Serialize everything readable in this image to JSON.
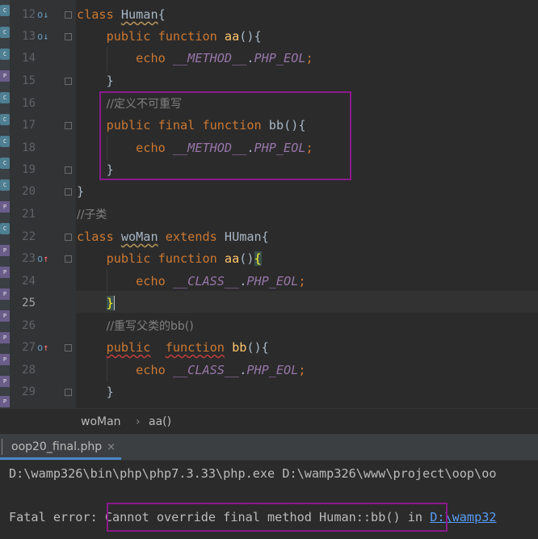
{
  "editor": {
    "line_numbers": [
      "12",
      "13",
      "14",
      "15",
      "16",
      "17",
      "18",
      "19",
      "20",
      "21",
      "22",
      "23",
      "24",
      "25",
      "26",
      "27",
      "28",
      "29"
    ],
    "active_line": "25",
    "lines": {
      "l12": {
        "kw": "class",
        "name": "Human",
        "brace": "{"
      },
      "l13": {
        "kw1": "public",
        "kw2": "function",
        "fn": "aa",
        "rest": "(){"
      },
      "l14": {
        "kw": "echo",
        "const1": "__METHOD__",
        "dot": ".",
        "const2": "PHP_EOL",
        "semi": ";"
      },
      "l15": {
        "text": "}"
      },
      "l16": {
        "comment": "//定义不可重写"
      },
      "l17": {
        "kw1": "public",
        "kw2": "final",
        "kw3": "function",
        "fn": "bb",
        "rest": "(){"
      },
      "l18": {
        "kw": "echo",
        "const1": "__METHOD__",
        "dot": ".",
        "const2": "PHP_EOL",
        "semi": ";"
      },
      "l19": {
        "text": "}"
      },
      "l20": {
        "text": "}"
      },
      "l21": {
        "comment": "//子类"
      },
      "l22": {
        "kw1": "class",
        "name": "woMan",
        "kw2": "extends",
        "parent": "HUman",
        "brace": "{"
      },
      "l23": {
        "kw1": "public",
        "kw2": "function",
        "fn": "aa",
        "rest": "()",
        "brace": "{"
      },
      "l24": {
        "kw": "echo",
        "const1": "__CLASS__",
        "dot": ".",
        "const2": "PHP_EOL",
        "semi": ";"
      },
      "l25": {
        "text": "}"
      },
      "l26": {
        "comment": "//重写父类的bb()"
      },
      "l27": {
        "kw1": "public",
        "kw2": "function",
        "fn": "bb",
        "rest": "(){"
      },
      "l28": {
        "kw": "echo",
        "const1": "__CLASS__",
        "dot": ".",
        "const2": "PHP_EOL",
        "semi": ";"
      },
      "l29": {
        "text": "}"
      }
    }
  },
  "breadcrumb": {
    "class": "woMan",
    "sep": "›",
    "method": "aa()"
  },
  "run": {
    "tab_label": "oop20_final.php",
    "close": "×"
  },
  "console": {
    "command": "D:\\wamp326\\bin\\php\\php7.3.33\\php.exe D:\\wamp326\\www\\project\\oop\\oo",
    "error_prefix": "Fatal error: ",
    "error_msg": "Cannot override final method Human::bb()",
    "error_in": " in ",
    "error_link": "D:\\wamp32"
  },
  "colors": {
    "highlight_box": "#8a1a8a",
    "keyword": "#cc7832",
    "function": "#ffc66d",
    "constant": "#9876aa"
  }
}
